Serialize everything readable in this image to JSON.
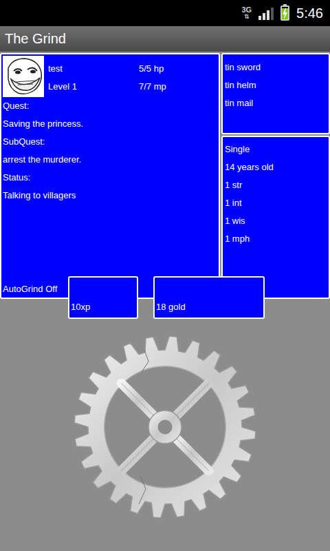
{
  "status_bar": {
    "network": "3G",
    "arrows": "⇅",
    "signal_level": 0.75,
    "battery_level": 0.9,
    "charging": true,
    "time": "5:46"
  },
  "window": {
    "title": "The Grind"
  },
  "character": {
    "name": "test",
    "level": "Level 1",
    "hp": "5/5 hp",
    "mp": "7/7 mp"
  },
  "quest": {
    "label": "Quest:",
    "value": "Saving the princess."
  },
  "subquest": {
    "label": "SubQuest:",
    "value": "arrest the murderer."
  },
  "status": {
    "label": "Status:",
    "value": "Talking to villagers"
  },
  "autogrind": "AutoGrind Off",
  "equipment": [
    "tin sword",
    "tin helm",
    "tin mail"
  ],
  "stats": [
    "Single",
    "14 years old",
    "1 str",
    "1 int",
    "1 wis",
    "1 mph"
  ],
  "xp": "10xp",
  "gold": "18 gold"
}
